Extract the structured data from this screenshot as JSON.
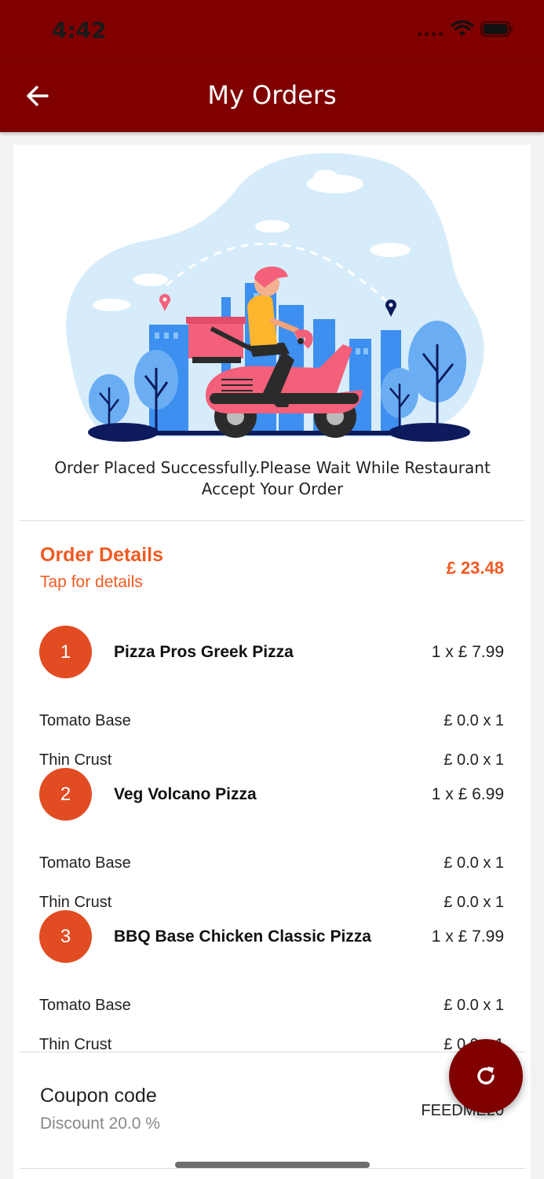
{
  "status_bar": {
    "time": "4:42"
  },
  "header": {
    "title": "My Orders",
    "back_icon": "arrow-left-icon"
  },
  "confirmation": {
    "message": "Order Placed Successfully.Please Wait While Restaurant Accept Your Order"
  },
  "order_details": {
    "title": "Order Details",
    "subtitle": "Tap for details",
    "total": "£ 23.48",
    "items": [
      {
        "index": "1",
        "name": "Pizza Pros Greek Pizza",
        "qty_price": "1 x £  7.99",
        "options": [
          {
            "name": "Tomato Base",
            "price": "£  0.0 x 1"
          },
          {
            "name": "Thin Crust",
            "price": "£  0.0 x 1"
          }
        ]
      },
      {
        "index": "2",
        "name": "Veg Volcano Pizza",
        "qty_price": "1 x £  6.99",
        "options": [
          {
            "name": "Tomato Base",
            "price": "£  0.0 x 1"
          },
          {
            "name": "Thin Crust",
            "price": "£  0.0 x 1"
          }
        ]
      },
      {
        "index": "3",
        "name": "BBQ Base Chicken Classic Pizza",
        "qty_price": "1 x £  7.99",
        "options": [
          {
            "name": "Tomato Base",
            "price": "£  0.0 x 1"
          },
          {
            "name": "Thin Crust",
            "price": "£  0.0 x 1"
          }
        ]
      }
    ]
  },
  "coupon": {
    "title": "Coupon code",
    "discount": "Discount 20.0 %",
    "code": "FEEDME20"
  },
  "fab": {
    "icon": "refresh-icon"
  },
  "colors": {
    "primary": "#800000",
    "accent": "#f05a22",
    "badge": "#e24c22"
  }
}
